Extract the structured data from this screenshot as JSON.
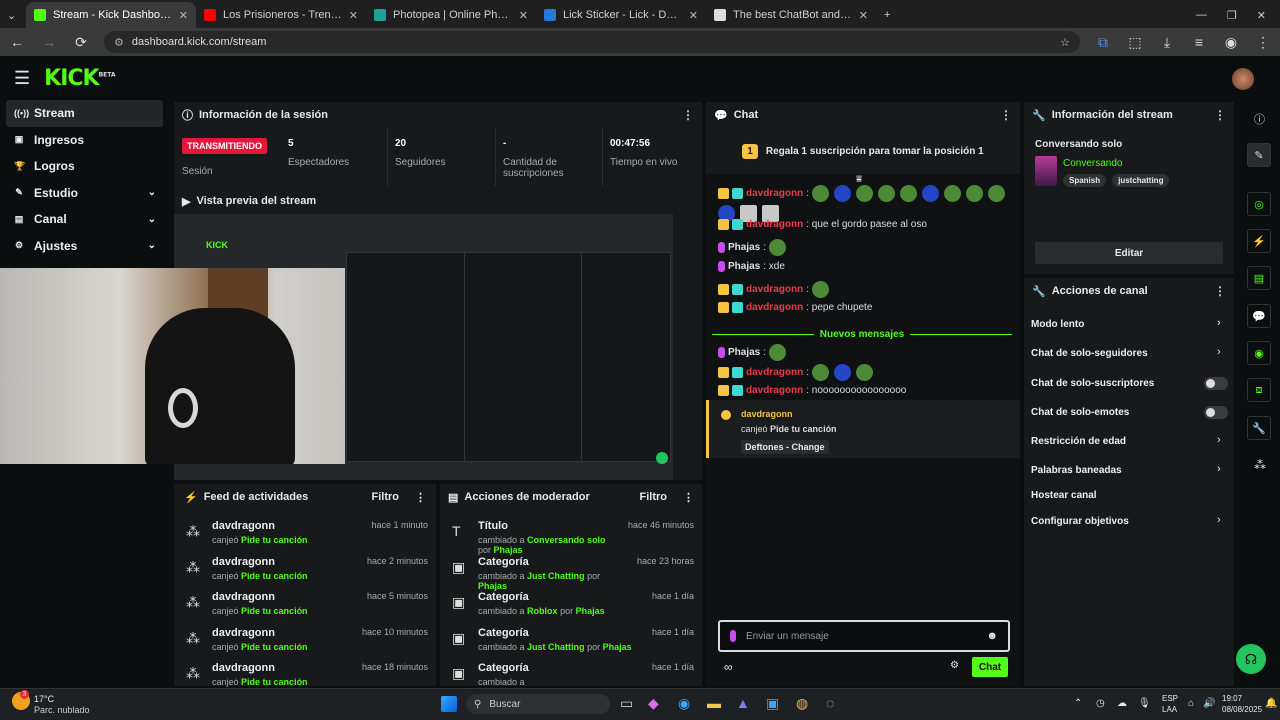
{
  "tabs": [
    {
      "title": "Stream - Kick Dashboard",
      "color": "#53fc18",
      "active": true
    },
    {
      "title": "Los Prisioneros - Tren Al Sur (A",
      "color": "#ff0000"
    },
    {
      "title": "Photopea | Online Photo Editor",
      "color": "#18a497"
    },
    {
      "title": "Lick Sticker - Lick - Descubrir y",
      "color": "#2b77d8"
    },
    {
      "title": "The best ChatBot and Widgets",
      "color": "#dddddd"
    }
  ],
  "browser": {
    "url": "dashboard.kick.com/stream",
    "new_tab": "+",
    "reload": "⟳"
  },
  "kick": {
    "logo": "KICK",
    "logo_sup": "BETA"
  },
  "sidebar": {
    "items": [
      {
        "label": "Stream",
        "icon": "((•))"
      },
      {
        "label": "Ingresos",
        "icon": "▣"
      },
      {
        "label": "Logros",
        "icon": "🏆"
      },
      {
        "label": "Estudio",
        "icon": "✎"
      },
      {
        "label": "Canal",
        "icon": "▤"
      },
      {
        "label": "Ajustes",
        "icon": "⚙"
      }
    ]
  },
  "session": {
    "title": "Información de la sesión",
    "badge": "TRANSMITIENDO",
    "session_label": "Sesión",
    "stats": [
      {
        "value": "5",
        "label": "Espectadores"
      },
      {
        "value": "20",
        "label": "Seguidores"
      },
      {
        "value": "-",
        "label": "Cantidad de suscripciones"
      },
      {
        "value": "00:47:56",
        "label": "Tiempo en vivo"
      }
    ]
  },
  "preview": {
    "title": "Vista previa del stream"
  },
  "feed": {
    "title": "Feed de actividades",
    "filter": "Filtro",
    "items": [
      {
        "name": "davdragonn",
        "action": "canjeó",
        "reward": "Pide tu canción",
        "time": "hace 1 minuto"
      },
      {
        "name": "davdragonn",
        "action": "canjeó",
        "reward": "Pide tu canción",
        "time": "hace 2 minutos"
      },
      {
        "name": "davdragonn",
        "action": "canjeó",
        "reward": "Pide tu canción",
        "time": "hace 5 minutos"
      },
      {
        "name": "davdragonn",
        "action": "canjeó",
        "reward": "Pide tu canción",
        "time": "hace 10 minutos"
      },
      {
        "name": "davdragonn",
        "action": "canjeó",
        "reward": "Pide tu canción",
        "time": "hace 18 minutos"
      }
    ]
  },
  "mod": {
    "title": "Acciones de moderador",
    "filter": "Filtro",
    "items": [
      {
        "name": "Título",
        "pre": "cambiado a",
        "value": "Conversando solo",
        "by": "por",
        "user": "Phajas",
        "time": "hace 46 minutos"
      },
      {
        "name": "Categoría",
        "pre": "cambiado a",
        "value": "Just Chatting",
        "by": "por",
        "user": "Phajas",
        "time": "hace 23 horas"
      },
      {
        "name": "Categoría",
        "pre": "cambiado a",
        "value": "Roblox",
        "by": "por",
        "user": "Phajas",
        "time": "hace 1 día"
      },
      {
        "name": "Categoría",
        "pre": "cambiado a",
        "value": "Just Chatting",
        "by": "por",
        "user": "Phajas",
        "time": "hace 1 día"
      },
      {
        "name": "Categoría",
        "pre": "cambiado a",
        "value": "",
        "by": "",
        "user": "",
        "time": "hace 1 día"
      }
    ]
  },
  "chat": {
    "title": "Chat",
    "gift_rank": "1",
    "gift_text": "Regala 1 suscripción para tomar la posición 1",
    "messages": [
      {
        "user": "davdragonn",
        "text": ":"
      },
      {
        "user": "davdragonn",
        "text": ": que el gordo pasee al oso"
      },
      {
        "user": "Phajas",
        "text": ":"
      },
      {
        "user": "Phajas",
        "text": ": xde"
      },
      {
        "user": "davdragonn",
        "text": ":"
      },
      {
        "user": "davdragonn",
        "text": ": pepe chupete"
      },
      {
        "user": "Phajas",
        "text": ":"
      },
      {
        "user": "davdragonn",
        "text": ":"
      },
      {
        "user": "davdragonn",
        "text": ": noooooooooooooooo"
      }
    ],
    "new_messages": "Nuevos mensajes",
    "redeem": {
      "user": "davdragonn",
      "action": "canjeó",
      "reward": "Pide tu canción",
      "song": "Deftones - Change"
    },
    "input_placeholder": "Enviar un mensaje",
    "send": "Chat"
  },
  "stream_info": {
    "title": "Información del stream",
    "stream_title": "Conversando solo",
    "category": "Conversando",
    "tags": [
      "Spanish",
      "justchatting"
    ],
    "edit": "Editar"
  },
  "channel_actions": {
    "title": "Acciones de canal",
    "items": [
      "Modo lento",
      "Chat de solo-seguidores",
      "Chat de solo-suscriptores",
      "Chat de solo-emotes",
      "Restricción de edad",
      "Palabras baneadas",
      "Hostear canal",
      "Configurar objetivos"
    ]
  },
  "taskbar": {
    "temp": "17°C",
    "weather": "Parc. nublado",
    "weather_badge": "3",
    "search": "Buscar",
    "lang": "ESP",
    "lang2": "LAA",
    "time": "19:07",
    "date": "08/08/2025"
  }
}
